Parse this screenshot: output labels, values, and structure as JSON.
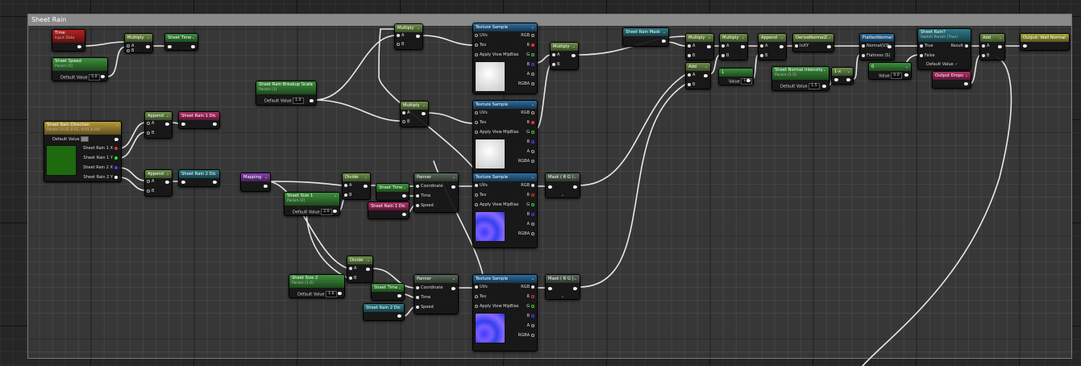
{
  "comment": {
    "title": "Sheet Rain"
  },
  "nodes": {
    "time": {
      "title": "Time",
      "subtitle": "Input Data"
    },
    "multiply_time": {
      "title": "Multiply"
    },
    "sheet_time_out": {
      "title": "Sheet Time"
    },
    "sheet_speed": {
      "title": "Sheet Speed",
      "subtitle": "Param (5)",
      "default_label": "Default Value",
      "value": "5.0"
    },
    "rain_direction": {
      "title": "Sheet Rain Direction",
      "subtitle": "Param (0.01,0.01,-0.01,0.05)",
      "default_label": "Default Value",
      "pins": [
        "Sheet Rain 1 X",
        "Sheet Rain 1 Y",
        "Sheet Rain 2 X",
        "Sheet Rain 2 Y"
      ]
    },
    "append1": {
      "title": "Append"
    },
    "dir1": {
      "title": "Sheet Rain 1 Dir"
    },
    "append2": {
      "title": "Append"
    },
    "dir2": {
      "title": "Sheet Rain 2 Dir"
    },
    "breakup_scale": {
      "title": "Sheet Rain Breakup Scale",
      "subtitle": "Param (1)",
      "default_label": "Default Value",
      "value": "1.0"
    },
    "multiply_a": {
      "title": "Multiply"
    },
    "multiply_b": {
      "title": "Multiply"
    },
    "tex1": {
      "title": "Texture Sample"
    },
    "tex2": {
      "title": "Texture Sample"
    },
    "tex3": {
      "title": "Texture Sample"
    },
    "tex4": {
      "title": "Texture Sample"
    },
    "tex_pins": {
      "uvs": "UVs",
      "tex": "Tex",
      "mip": "Apply View MipBias",
      "rgb": "RGB",
      "r": "R",
      "g": "G",
      "b": "B",
      "a": "A",
      "rgba": "RGBA"
    },
    "multiply_mid": {
      "title": "Multiply"
    },
    "mapping": {
      "title": "Mapping"
    },
    "divide1": {
      "title": "Divide"
    },
    "sheet_size1": {
      "title": "Sheet Size 1",
      "subtitle": "Param (2)",
      "default_label": "Default Value",
      "value": "2.0"
    },
    "sheet_time_1": {
      "title": "Sheet Time"
    },
    "rain1dir_1": {
      "title": "Sheet Rain 1 Dir"
    },
    "panner1": {
      "title": "Panner"
    },
    "mask1": {
      "title": "Mask ( R G )"
    },
    "divide2": {
      "title": "Divide"
    },
    "sheet_size2": {
      "title": "Sheet Size 2",
      "subtitle": "Param (1.6)",
      "default_label": "Default Value",
      "value": "1.6"
    },
    "sheet_time_2": {
      "title": "Sheet Time"
    },
    "rain2dir_2": {
      "title": "Sheet Rain 2 Dir"
    },
    "panner2": {
      "title": "Panner"
    },
    "panner_pins": {
      "coord": "Coordinate",
      "time": "Time",
      "speed": "Speed"
    },
    "mask2": {
      "title": "Mask ( R G )"
    },
    "rain_mask": {
      "title": "Sheet Rain Mask"
    },
    "multiply_r1": {
      "title": "Multiply"
    },
    "add_r1": {
      "title": "Add"
    },
    "multiply_r2": {
      "title": "Multiply"
    },
    "const1": {
      "title": "1",
      "value_label": "Value",
      "value": "1.0"
    },
    "append_r": {
      "title": "Append"
    },
    "derive_normal": {
      "title": "DeriveNormalZ",
      "pin": "InXY"
    },
    "normal_intensity": {
      "title": "Sheet Normal Intensity",
      "subtitle": "Param (1.5)",
      "default_label": "Default Value",
      "value": "1.5"
    },
    "one_minus": {
      "title": "1-x"
    },
    "flatten": {
      "title": "FlattenNormal",
      "pin1": "Normal(V3)",
      "pin2": "Flatness (S)"
    },
    "const0": {
      "title": "0",
      "value_label": "Value",
      "value": "0.0"
    },
    "switch": {
      "title": "Sheet Rain?",
      "subtitle": "Switch Param (True)",
      "t": "True",
      "f": "False",
      "res": "Result",
      "def": "Default Value"
    },
    "output_drops": {
      "title": "Output Drops"
    },
    "add_final": {
      "title": "Add"
    },
    "output_wall": {
      "title": "Output: Wall Normal"
    }
  },
  "ab": {
    "a": "A",
    "b": "B"
  },
  "chevron": "⌄"
}
